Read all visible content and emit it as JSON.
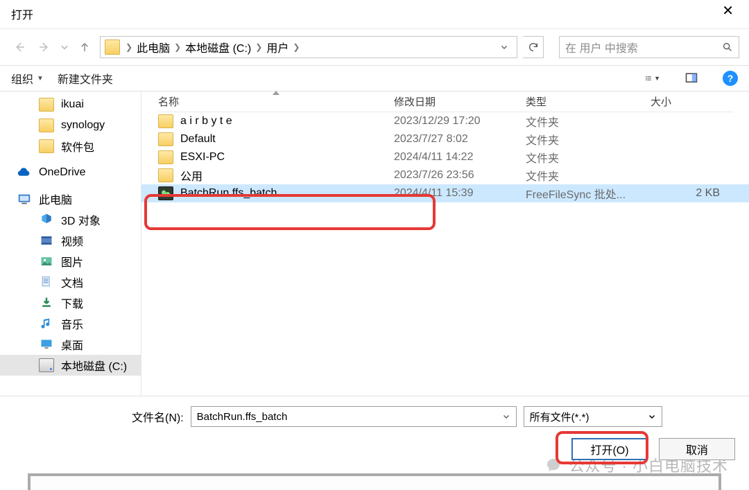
{
  "title": "打开",
  "breadcrumb": [
    "此电脑",
    "本地磁盘 (C:)",
    "用户"
  ],
  "search_placeholder": "在 用户 中搜索",
  "toolbar": {
    "organize": "组织",
    "new_folder": "新建文件夹"
  },
  "sidebar": {
    "folders": [
      "ikuai",
      "synology",
      "软件包"
    ],
    "onedrive": "OneDrive",
    "this_pc": "此电脑",
    "pc_children": [
      "3D 对象",
      "视频",
      "图片",
      "文档",
      "下载",
      "音乐",
      "桌面",
      "本地磁盘 (C:)"
    ],
    "selected": "本地磁盘 (C:)"
  },
  "columns": {
    "name": "名称",
    "date": "修改日期",
    "type": "类型",
    "size": "大小"
  },
  "rows": [
    {
      "name": "a i r b y t e",
      "date": "2023/12/29 17:20",
      "type": "文件夹",
      "size": "",
      "icon": "folder"
    },
    {
      "name": "Default",
      "date": "2023/7/27 8:02",
      "type": "文件夹",
      "size": "",
      "icon": "folder"
    },
    {
      "name": "ESXI-PC",
      "date": "2024/4/11 14:22",
      "type": "文件夹",
      "size": "",
      "icon": "folder"
    },
    {
      "name": "公用",
      "date": "2023/7/26 23:56",
      "type": "文件夹",
      "size": "",
      "icon": "folder"
    },
    {
      "name": "BatchRun.ffs_batch",
      "date": "2024/4/11 15:39",
      "type": "FreeFileSync 批处...",
      "size": "2 KB",
      "icon": "ffs",
      "selected": true
    }
  ],
  "filename_label": "文件名(N):",
  "filename_value": "BatchRun.ffs_batch",
  "filter_value": "所有文件(*.*)",
  "buttons": {
    "open": "打开(O)",
    "cancel": "取消"
  },
  "watermark": "公众号 · 小白电脑技术"
}
